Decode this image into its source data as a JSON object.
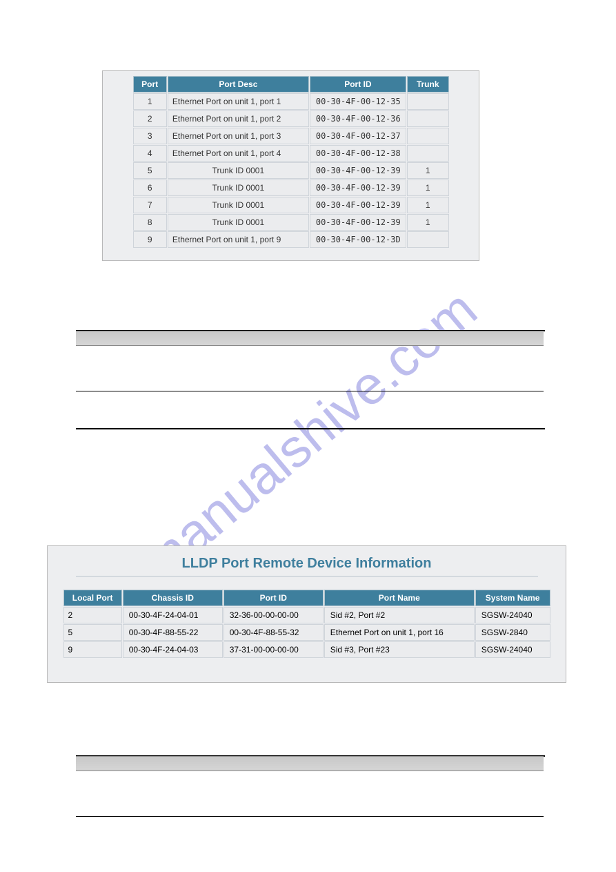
{
  "watermark": "manualshive.com",
  "table1": {
    "headers": [
      "Port",
      "Port Desc",
      "Port ID",
      "Trunk"
    ],
    "rows": [
      {
        "port": "1",
        "desc": "Ethernet Port on unit 1, port 1",
        "id": "00-30-4F-00-12-35",
        "trunk": ""
      },
      {
        "port": "2",
        "desc": "Ethernet Port on unit 1, port 2",
        "id": "00-30-4F-00-12-36",
        "trunk": ""
      },
      {
        "port": "3",
        "desc": "Ethernet Port on unit 1, port 3",
        "id": "00-30-4F-00-12-37",
        "trunk": ""
      },
      {
        "port": "4",
        "desc": "Ethernet Port on unit 1, port 4",
        "id": "00-30-4F-00-12-38",
        "trunk": ""
      },
      {
        "port": "5",
        "desc": "Trunk ID 0001",
        "id": "00-30-4F-00-12-39",
        "trunk": "1"
      },
      {
        "port": "6",
        "desc": "Trunk ID 0001",
        "id": "00-30-4F-00-12-39",
        "trunk": "1"
      },
      {
        "port": "7",
        "desc": "Trunk ID 0001",
        "id": "00-30-4F-00-12-39",
        "trunk": "1"
      },
      {
        "port": "8",
        "desc": "Trunk ID 0001",
        "id": "00-30-4F-00-12-39",
        "trunk": "1"
      },
      {
        "port": "9",
        "desc": "Ethernet Port on unit 1, port 9",
        "id": "00-30-4F-00-12-3D",
        "trunk": ""
      }
    ]
  },
  "figure2": {
    "title": "LLDP Port Remote Device Information",
    "headers": [
      "Local Port",
      "Chassis ID",
      "Port ID",
      "Port Name",
      "System Name"
    ],
    "rows": [
      {
        "localport": "2",
        "chassis": "00-30-4F-24-04-01",
        "portid": "32-36-00-00-00-00",
        "portname": "Sid #2, Port #2",
        "sysname": "SGSW-24040"
      },
      {
        "localport": "5",
        "chassis": "00-30-4F-88-55-22",
        "portid": "00-30-4F-88-55-32",
        "portname": "Ethernet Port on unit 1, port 16",
        "sysname": "SGSW-2840"
      },
      {
        "localport": "9",
        "chassis": "00-30-4F-24-04-03",
        "portid": "37-31-00-00-00-00",
        "portname": "Sid #3, Port #23",
        "sysname": "SGSW-24040"
      }
    ]
  }
}
